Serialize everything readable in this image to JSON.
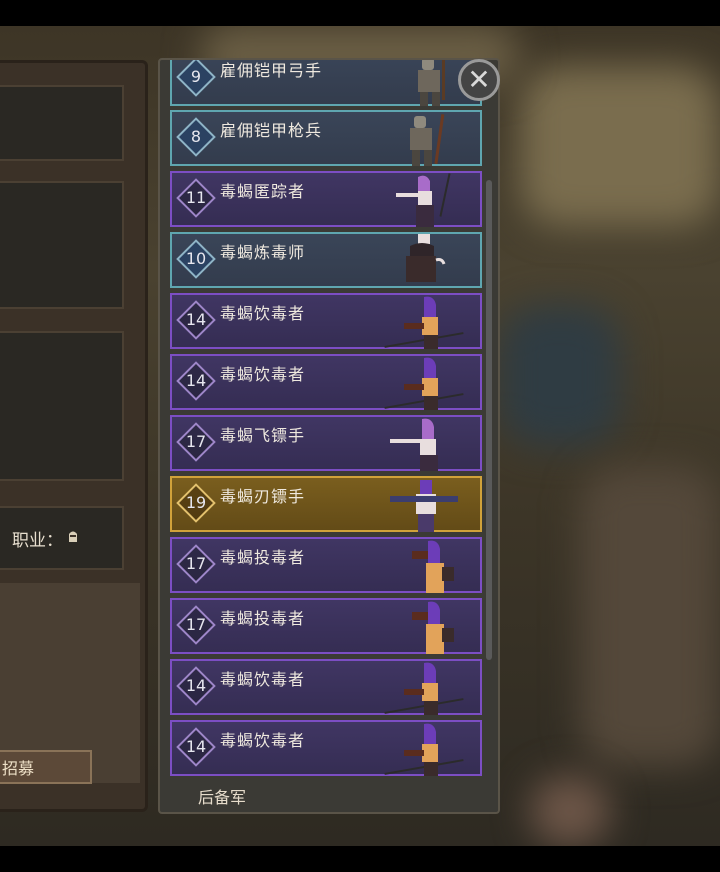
{
  "left_panel": {
    "class_label": "职业：",
    "recruit_label": "招募"
  },
  "list": {
    "close_symbol": "✕",
    "reserve_label": "后备军",
    "units": [
      {
        "level": "9",
        "name": "雇佣铠甲弓手",
        "style": "teal",
        "figure": "knight-figure"
      },
      {
        "level": "8",
        "name": "雇佣铠甲枪兵",
        "style": "teal",
        "figure": "knight-figure"
      },
      {
        "level": "11",
        "name": "毒蝎匿踪者",
        "style": "purple",
        "figure": "hooded-figure"
      },
      {
        "level": "10",
        "name": "毒蝎炼毒师",
        "style": "teal",
        "figure": "hooded-figure"
      },
      {
        "level": "14",
        "name": "毒蝎饮毒者",
        "style": "purple",
        "figure": "hooded-figure"
      },
      {
        "level": "14",
        "name": "毒蝎饮毒者",
        "style": "purple",
        "figure": "hooded-figure"
      },
      {
        "level": "17",
        "name": "毒蝎飞镖手",
        "style": "purple",
        "figure": "hooded-figure"
      },
      {
        "level": "19",
        "name": "毒蝎刃镖手",
        "style": "gold",
        "figure": "hooded-figure"
      },
      {
        "level": "17",
        "name": "毒蝎投毒者",
        "style": "purple",
        "figure": "hooded-figure"
      },
      {
        "level": "17",
        "name": "毒蝎投毒者",
        "style": "purple",
        "figure": "hooded-figure"
      },
      {
        "level": "14",
        "name": "毒蝎饮毒者",
        "style": "purple",
        "figure": "hooded-figure"
      },
      {
        "level": "14",
        "name": "毒蝎饮毒者",
        "style": "purple",
        "figure": "hooded-figure"
      }
    ]
  }
}
